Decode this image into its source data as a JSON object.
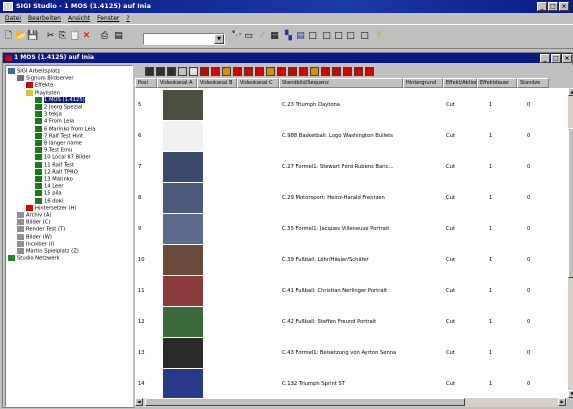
{
  "window": {
    "title": "SIGI Studio - 1 MOS (1.4125) auf Inia"
  },
  "menu": [
    "Datei",
    "Bearbeiten",
    "Ansicht",
    "Fenster",
    "?"
  ],
  "child": {
    "title": "1 MOS (1.4125) auf Inia"
  },
  "tree": {
    "nodes": [
      {
        "label": "SIGI Arbeitsplatz",
        "level": 0,
        "icon": "pc-icon"
      },
      {
        "label": "Signum Bildserver",
        "level": 1,
        "icon": "server-icon"
      },
      {
        "label": "Effekte",
        "level": 2,
        "icon": "effects-icon"
      },
      {
        "label": "Playlisten",
        "level": 2,
        "icon": "folder-icon"
      },
      {
        "label": "1 MOS (1.4125)",
        "level": 3,
        "icon": "playlist-icon",
        "selected": true
      },
      {
        "label": "2 Joerg Spezial",
        "level": 3,
        "icon": "playlist-icon"
      },
      {
        "label": "3 tekja",
        "level": 3,
        "icon": "playlist-icon"
      },
      {
        "label": "4 From Leia",
        "level": 3,
        "icon": "playlist-icon"
      },
      {
        "label": "6 Marinko from Leia",
        "level": 3,
        "icon": "playlist-icon"
      },
      {
        "label": "7 Ralf Test Hint",
        "level": 3,
        "icon": "playlist-icon"
      },
      {
        "label": "8 langer name",
        "level": 3,
        "icon": "playlist-icon"
      },
      {
        "label": "9 Test Emu",
        "level": 3,
        "icon": "playlist-icon"
      },
      {
        "label": "10 Local 87 Bilder",
        "level": 3,
        "icon": "playlist-icon"
      },
      {
        "label": "11 Ralf Test",
        "level": 3,
        "icon": "playlist-icon"
      },
      {
        "label": "12 Ralf TPRO",
        "level": 3,
        "icon": "playlist-icon"
      },
      {
        "label": "13 Marinko",
        "level": 3,
        "icon": "playlist-icon"
      },
      {
        "label": "14 Leer",
        "level": 3,
        "icon": "playlist-icon"
      },
      {
        "label": "15 pila",
        "level": 3,
        "icon": "playlist-icon"
      },
      {
        "label": "16 doki",
        "level": 3,
        "icon": "playlist-icon"
      },
      {
        "label": "Hintersetzer (H)",
        "level": 2,
        "icon": "red-icon"
      },
      {
        "label": "Archiv (A)",
        "level": 1,
        "icon": "drive-icon"
      },
      {
        "label": "Bilder (C)",
        "level": 1,
        "icon": "drive-icon"
      },
      {
        "label": "Render Test (T)",
        "level": 1,
        "icon": "drive-icon"
      },
      {
        "label": "Bilder (W)",
        "level": 1,
        "icon": "drive-icon"
      },
      {
        "label": "Incoiber (I)",
        "level": 1,
        "icon": "drive-icon"
      },
      {
        "label": "Martin Spielplatz (Z)",
        "level": 1,
        "icon": "drive-icon"
      },
      {
        "label": "Studio Netzwerk",
        "level": 0,
        "icon": "network-icon"
      }
    ]
  },
  "columns": [
    "Posi",
    "Videokanal A",
    "Videokanal B",
    "Videokanal C",
    "Standbild/Sequenz",
    "Hintergrund",
    "Effekt/Aktion",
    "Effektdauer",
    "Standze"
  ],
  "rows": [
    {
      "pos": "5",
      "name": "C.23 Triumph Daytona",
      "effect": "Cut",
      "duration": "1",
      "stand": "0",
      "thumb": "#4a5040"
    },
    {
      "pos": "6",
      "name": "C.988 Basketball: Logo Washington Bullets",
      "effect": "Cut",
      "duration": "1",
      "stand": "0",
      "thumb": "#f0f0f0"
    },
    {
      "pos": "7",
      "name": "C.27 Formel1: Stewart Ford Rubens Baric...",
      "effect": "Cut",
      "duration": "1",
      "stand": "0",
      "thumb": "#3a4a6a"
    },
    {
      "pos": "8",
      "name": "C.29 Motorsport: Heinz-Harald Frentzen",
      "effect": "Cut",
      "duration": "1",
      "stand": "0",
      "thumb": "#4a5a7a"
    },
    {
      "pos": "9",
      "name": "C.35 Formel1: Jacques Villeneuve Portrait",
      "effect": "Cut",
      "duration": "1",
      "stand": "0",
      "thumb": "#5a6a8a"
    },
    {
      "pos": "10",
      "name": "C.39 Fußball: Löhr/Häsler/Schäfer",
      "effect": "Cut",
      "duration": "1",
      "stand": "0",
      "thumb": "#6a4a3a"
    },
    {
      "pos": "11",
      "name": "C.41 Fußball: Christian Nerlinger Portrait",
      "effect": "Cut",
      "duration": "1",
      "stand": "0",
      "thumb": "#8a3a3a"
    },
    {
      "pos": "12",
      "name": "C.42 Fußball: Steffen Freund Portrait",
      "effect": "Cut",
      "duration": "1",
      "stand": "0",
      "thumb": "#3a6a3a"
    },
    {
      "pos": "13",
      "name": "C.43 Formel1: Beisetzung von Ayrton Senna",
      "effect": "Cut",
      "duration": "1",
      "stand": "0",
      "thumb": "#2a2a2a"
    },
    {
      "pos": "14",
      "name": "C.132 Triumph Sprint ST",
      "effect": "Cut",
      "duration": "1",
      "stand": "0",
      "thumb": "#2a3a8a"
    }
  ],
  "colors": {
    "titlebar": "#0a1a82",
    "selection": "#0a1a82",
    "accent": "#d40000"
  }
}
